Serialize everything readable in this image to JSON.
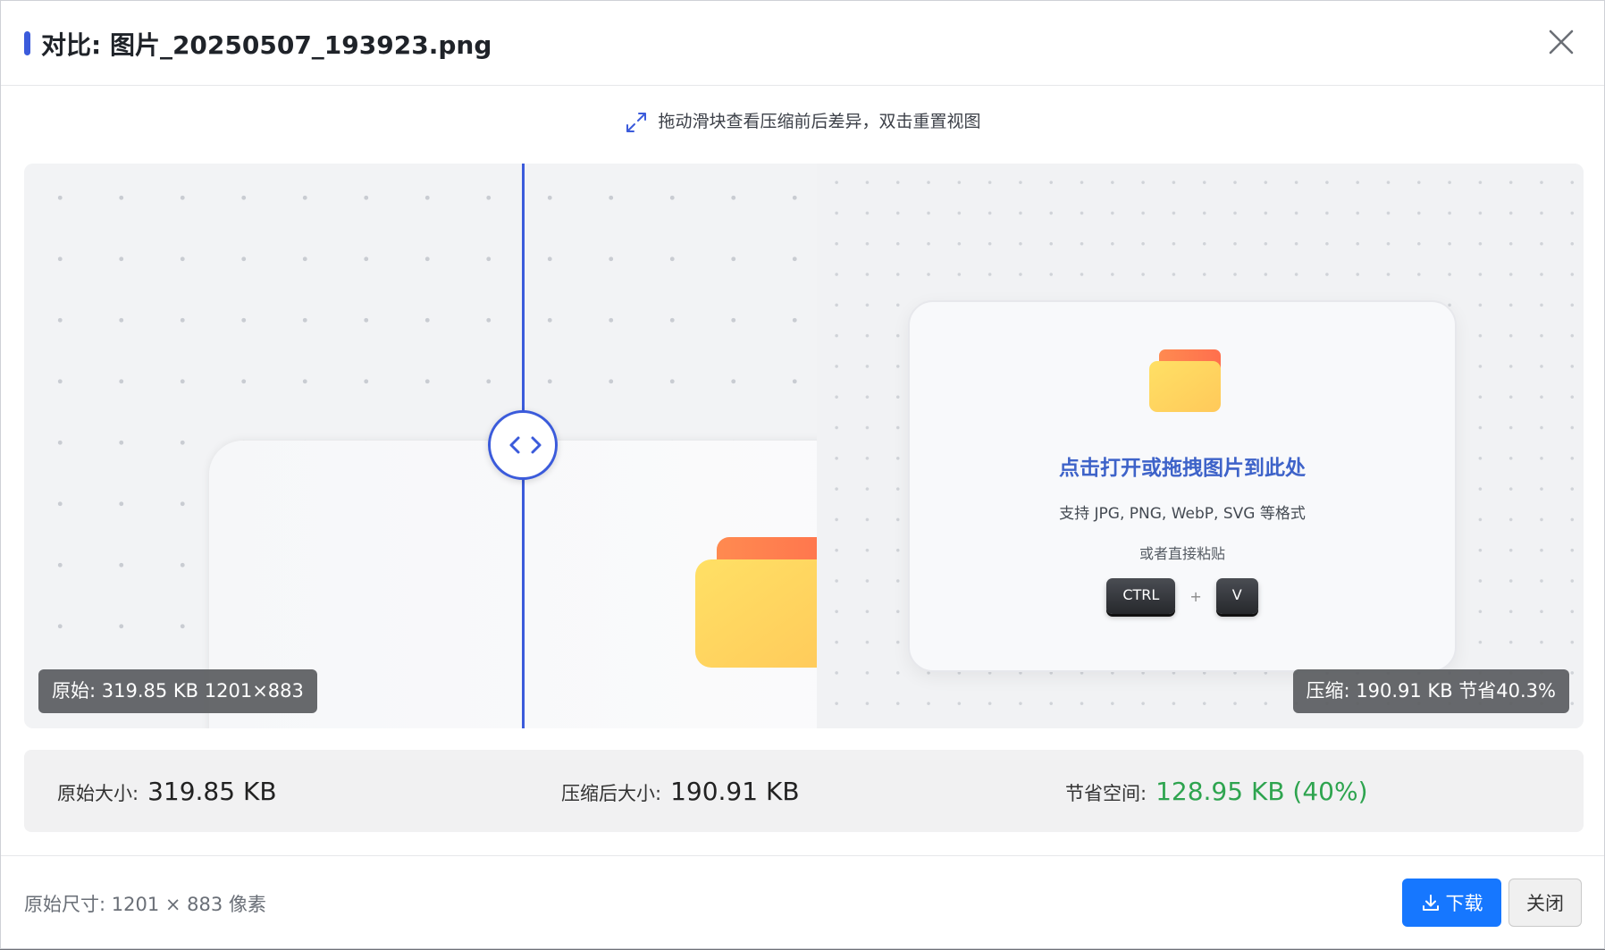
{
  "dialog": {
    "title": "对比: 图片_20250507_193923.png",
    "accent_color": "#3b5bdb"
  },
  "hint": {
    "text": "拖动滑块查看压缩前后差异，双击重置视图",
    "icon": "expand-arrows-icon"
  },
  "compare": {
    "slider_position": 0.32,
    "left_tag": "原始: 319.85 KB 1201×883",
    "right_tag": "压缩: 190.91 KB 节省40.3%",
    "preview": {
      "title": "点击打开或拖拽图片到此处",
      "subtitle": "支持 JPG, PNG, WebP, SVG 等格式",
      "or_text": "或者直接粘贴",
      "key_ctrl": "CTRL",
      "key_plus": "+",
      "key_v": "V",
      "folder_icon": "folder-icon"
    }
  },
  "stats": {
    "original_label": "原始大小:",
    "original_value": "319.85 KB",
    "compressed_label": "压缩后大小:",
    "compressed_value": "190.91 KB",
    "saved_label": "节省空间:",
    "saved_value": "128.95 KB (40%)",
    "saved_color": "#2ea44f"
  },
  "footer": {
    "dimensions": "原始尺寸: 1201 × 883 像素",
    "download_label": "下载",
    "close_label": "关闭",
    "download_color": "#1677ff"
  }
}
